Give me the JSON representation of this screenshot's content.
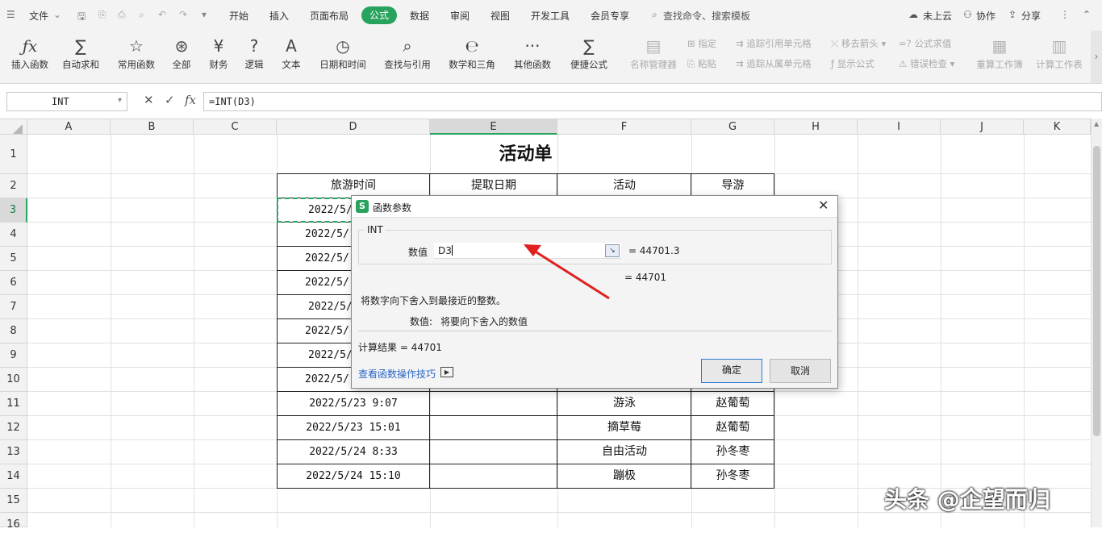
{
  "menubar": {
    "file": "文件",
    "tabs": [
      "开始",
      "插入",
      "页面布局",
      "公式",
      "数据",
      "审阅",
      "视图",
      "开发工具",
      "会员专享"
    ],
    "search": "查找命令、搜索模板",
    "cloud": "未上云",
    "collab": "协作",
    "share": "分享"
  },
  "ribbon": {
    "insert_func": "插入函数",
    "autosum": "自动求和",
    "common": "常用函数",
    "all": "全部",
    "finance": "财务",
    "logic": "逻辑",
    "text": "文本",
    "datetime": "日期和时间",
    "lookup": "查找与引用",
    "math": "数学和三角",
    "other": "其他函数",
    "quick": "便捷公式",
    "name_mgr": "名称管理器",
    "specify": "指定",
    "paste": "粘贴",
    "trace_prec": "追踪引用单元格",
    "trace_dep": "追踪从属单元格",
    "remove_arrows": "移去箭头",
    "show_formula": "显示公式",
    "eval_formula": "公式求值",
    "error_check": "错误检查",
    "recalc": "重算工作簿",
    "calc_sheet": "计算工作表"
  },
  "formula_bar": {
    "name_box": "INT",
    "formula": "=INT(D3)"
  },
  "columns": [
    "A",
    "B",
    "C",
    "D",
    "E",
    "F",
    "G",
    "H",
    "I",
    "J",
    "K"
  ],
  "rows": [
    "1",
    "2",
    "3",
    "4",
    "5",
    "6",
    "7",
    "8",
    "9",
    "10",
    "11",
    "12",
    "13",
    "14",
    "15",
    "16"
  ],
  "sheet": {
    "title": "活动单",
    "headers": [
      "旅游时间",
      "提取日期",
      "活动",
      "导游"
    ],
    "d_partial": [
      "2022/5/",
      "2022/5/",
      "2022/5/",
      "2022/5/",
      "2022/5/",
      "2022/5/",
      "2022/5/",
      "2022/5/"
    ],
    "rows": [
      {
        "time": "2022/5/23 9:07",
        "activity": "游泳",
        "guide": "赵葡萄"
      },
      {
        "time": "2022/5/23 15:01",
        "activity": "摘草莓",
        "guide": "赵葡萄"
      },
      {
        "time": "2022/5/24 8:33",
        "activity": "自由活动",
        "guide": "孙冬枣"
      },
      {
        "time": "2022/5/24 15:10",
        "activity": "蹦极",
        "guide": "孙冬枣"
      }
    ]
  },
  "dialog": {
    "title": "函数参数",
    "func_name": "INT",
    "arg_label": "数值",
    "arg_value": "D3",
    "arg_result": "= 44701.3",
    "func_result": "= 44701",
    "description": "将数字向下舍入到最接近的整数。",
    "arg_desc_label": "数值:",
    "arg_desc": "将要向下舍入的数值",
    "calc_result": "计算结果 =  44701",
    "help_link": "查看函数操作技巧",
    "ok": "确定",
    "cancel": "取消"
  },
  "watermark": "头条 @企望而归",
  "colors": {
    "accent": "#27a35e",
    "arrow": "#e02020",
    "link": "#2a66c6"
  }
}
